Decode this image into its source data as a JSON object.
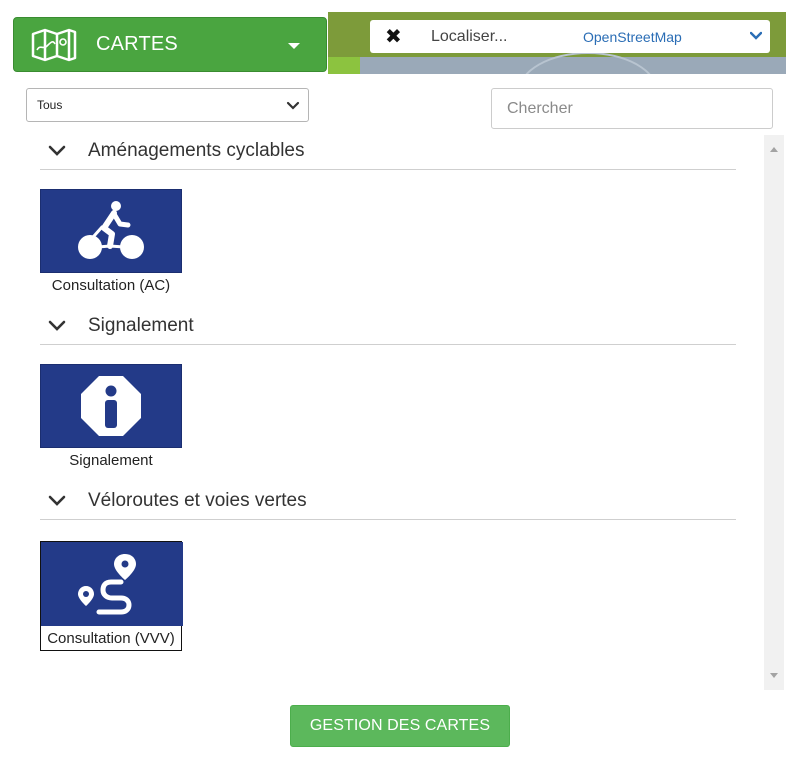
{
  "header": {
    "cartes_label": "CARTES",
    "locate_placeholder": "Localiser...",
    "basemap_selected": "OpenStreetMap",
    "close_symbol": "✖"
  },
  "filter": {
    "selected": "Tous",
    "search_placeholder": "Chercher"
  },
  "sections": [
    {
      "title": "Aménagements cyclables",
      "tiles": [
        {
          "caption": "Consultation (AC)",
          "icon": "bicycle-icon"
        }
      ]
    },
    {
      "title": "Signalement",
      "tiles": [
        {
          "caption": "Signalement",
          "icon": "info-icon"
        }
      ]
    },
    {
      "title": "Véloroutes et voies vertes",
      "tiles": [
        {
          "caption": "Consultation (VVV)",
          "icon": "route-icon"
        }
      ]
    }
  ],
  "footer": {
    "manage_label": "GESTION DES CARTES"
  },
  "colors": {
    "accent_green": "#4aa540",
    "button_green": "#5cb85c",
    "tile_blue": "#233a88",
    "link_blue": "#2a6db5"
  }
}
